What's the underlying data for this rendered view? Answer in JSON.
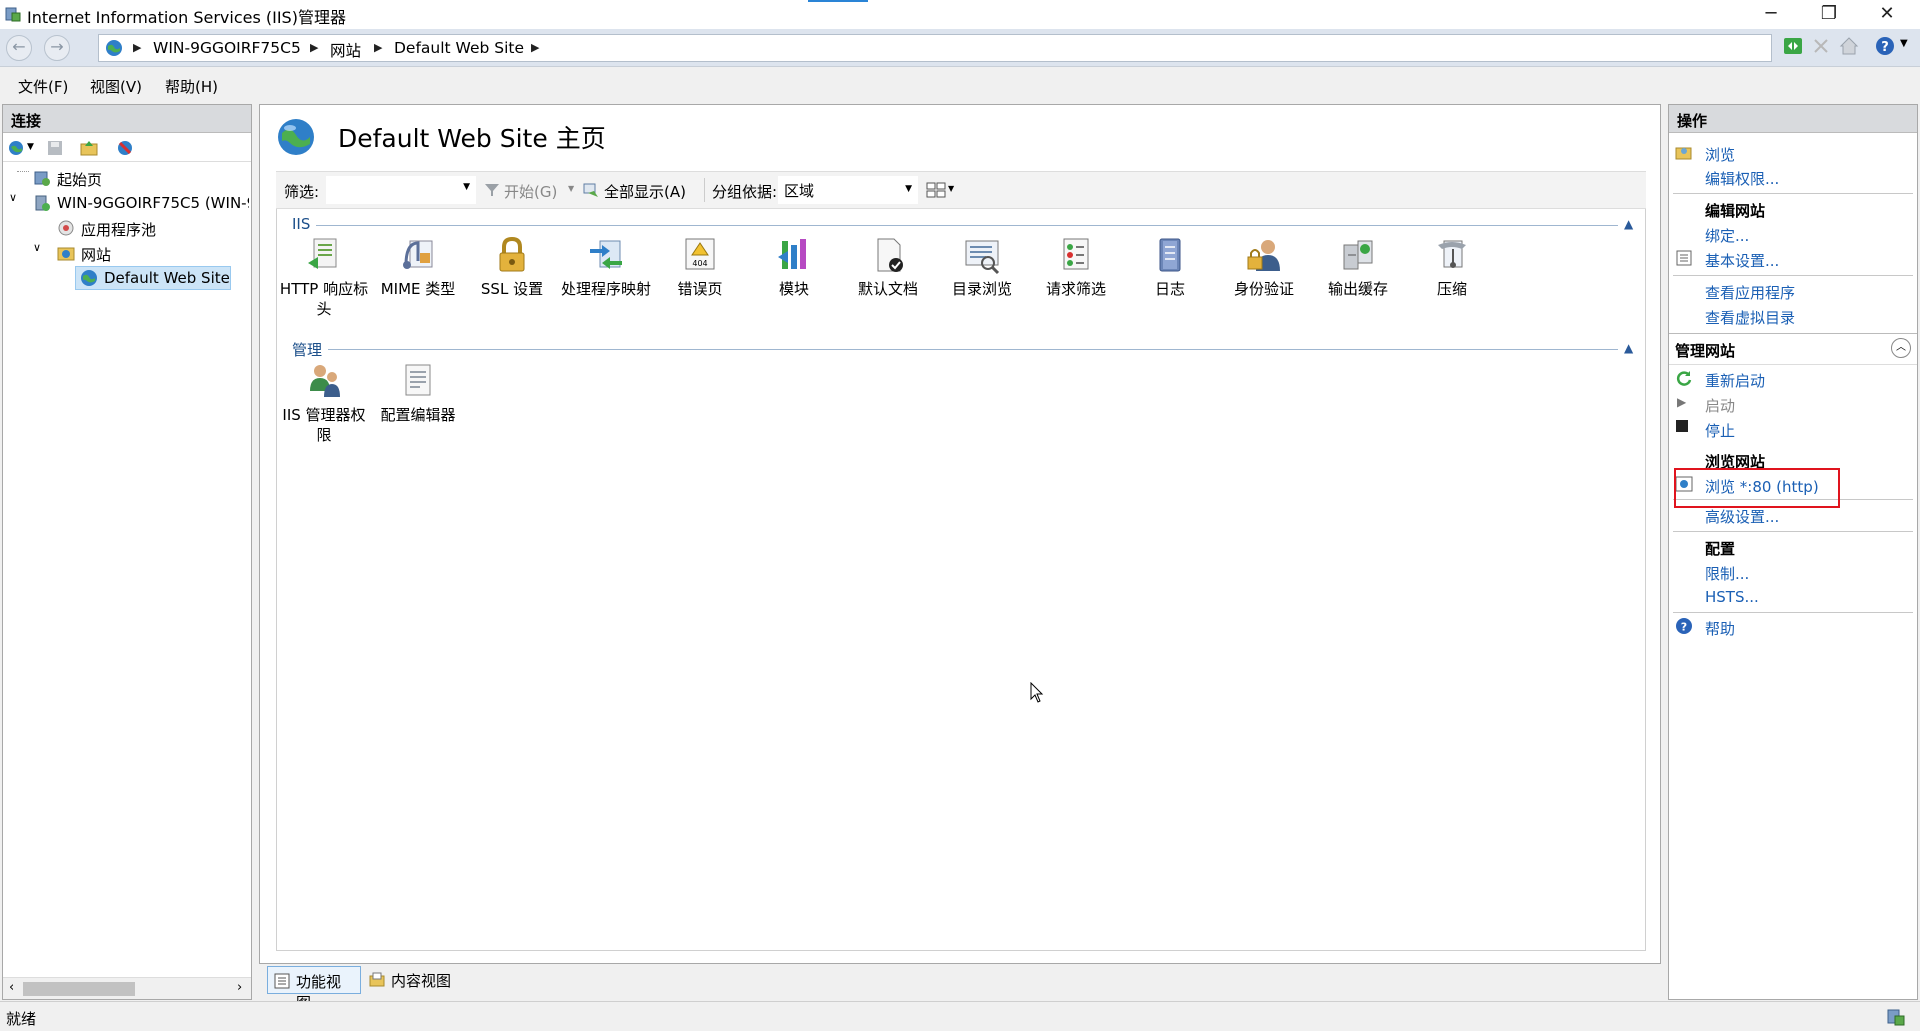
{
  "window": {
    "title": "Internet Information Services (IIS)管理器",
    "minimize": "─",
    "restore": "❐",
    "close": "✕"
  },
  "address": {
    "crumbs": [
      "WIN-9GGOIRF75C5",
      "网站",
      "Default Web Site"
    ]
  },
  "menu": [
    "文件(F)",
    "视图(V)",
    "帮助(H)"
  ],
  "connections": {
    "header": "连接",
    "tree": {
      "start_page": "起始页",
      "server": "WIN-9GGOIRF75C5 (WIN-9",
      "app_pools": "应用程序池",
      "sites": "网站",
      "default_site": "Default Web Site"
    }
  },
  "center": {
    "title": "Default Web Site 主页",
    "filter_label": "筛选:",
    "start_label": "开始(G)",
    "show_all_label": "全部显示(A)",
    "group_by_label": "分组依据:",
    "group_by_value": "区域",
    "groups": [
      {
        "name": "IIS",
        "features": [
          {
            "label": "HTTP 响应标头",
            "icon": "http-headers-icon"
          },
          {
            "label": "MIME 类型",
            "icon": "mime-icon"
          },
          {
            "label": "SSL 设置",
            "icon": "lock-icon"
          },
          {
            "label": "处理程序映射",
            "icon": "handler-icon"
          },
          {
            "label": "错误页",
            "icon": "error-page-icon"
          },
          {
            "label": "模块",
            "icon": "modules-icon"
          },
          {
            "label": "默认文档",
            "icon": "default-doc-icon"
          },
          {
            "label": "目录浏览",
            "icon": "dir-browse-icon"
          },
          {
            "label": "请求筛选",
            "icon": "request-filter-icon"
          },
          {
            "label": "日志",
            "icon": "log-icon"
          },
          {
            "label": "身份验证",
            "icon": "auth-icon"
          },
          {
            "label": "输出缓存",
            "icon": "cache-icon"
          },
          {
            "label": "压缩",
            "icon": "compress-icon"
          }
        ]
      },
      {
        "name": "管理",
        "features": [
          {
            "label": "IIS 管理器权限",
            "icon": "permissions-icon"
          },
          {
            "label": "配置编辑器",
            "icon": "config-editor-icon"
          }
        ]
      }
    ],
    "tabs": [
      "功能视图",
      "内容视图"
    ]
  },
  "actions": {
    "header": "操作",
    "browse": "浏览",
    "edit_perms": "编辑权限...",
    "edit_site_head": "编辑网站",
    "bindings": "绑定...",
    "basic_settings": "基本设置...",
    "view_apps": "查看应用程序",
    "view_vdirs": "查看虚拟目录",
    "manage_head": "管理网站",
    "restart": "重新启动",
    "start": "启动",
    "stop": "停止",
    "browse_head": "浏览网站",
    "browse_80": "浏览 *:80 (http)",
    "advanced": "高级设置...",
    "config_head": "配置",
    "limits": "限制...",
    "hsts": "HSTS...",
    "help": "帮助"
  },
  "status": "就绪"
}
